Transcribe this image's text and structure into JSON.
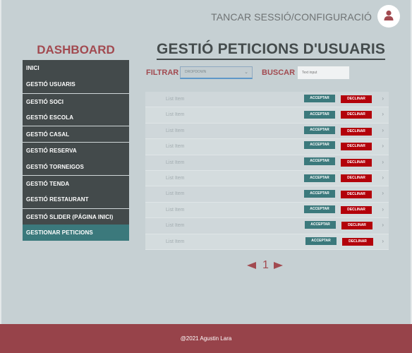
{
  "header": {
    "session_link": "TANCAR SESSIÓ/CONFIGURACIÓ",
    "avatar_icon": "user-icon"
  },
  "sidebar": {
    "title": "DASHBOARD",
    "items": [
      {
        "label": "INICI"
      },
      {
        "label": "GESTIÓ USUARIS"
      },
      {
        "label": "GESTIÓ SOCI"
      },
      {
        "label": "GESTIÓ ESCOLA"
      },
      {
        "label": "GESTIÓ CASAL"
      },
      {
        "label": "GESTIÓ RESERVA"
      },
      {
        "label": "GESTIÓ TORNEIGOS"
      },
      {
        "label": "GESTIÓ TENDA"
      },
      {
        "label": "GESTIÓ RESTAURANT"
      },
      {
        "label": "GESTIÓ SLIDER (PÁGINA INICI)"
      },
      {
        "label": "GESTIONAR PETICIONS",
        "active": true
      }
    ]
  },
  "main": {
    "title": "GESTIÓ PETICIONS D'USUARIS",
    "filter_label": "FILTRAR",
    "dropdown_value": "DROPDOWN",
    "search_label": "BUSCAR",
    "search_placeholder": "Text input",
    "accept_label": "ACCEPTAR",
    "decline_label": "DECLINAR",
    "list_items": [
      "List Item",
      "List Item",
      "List Item",
      "List Item",
      "List Item",
      "List Item",
      "List Item",
      "List Item",
      "List Item",
      "List Item"
    ],
    "page_number": "1"
  },
  "footer": {
    "copyright": "@2021 Agustin Lara"
  },
  "colors": {
    "background": "#c6d0d3",
    "accent_red": "#a24a50",
    "sidebar_dark": "#434a4b",
    "teal": "#3b797c",
    "decline_red": "#b3020b",
    "footer": "#97434a"
  }
}
